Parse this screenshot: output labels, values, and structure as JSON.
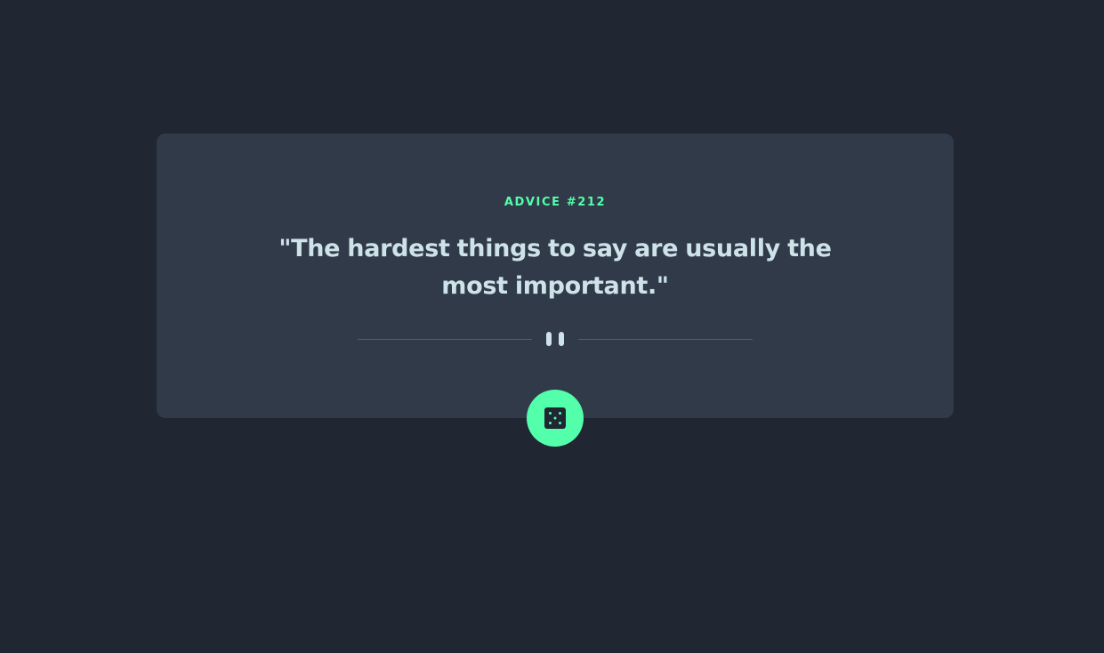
{
  "advice": {
    "label": "ADVICE #212",
    "text": "\"The hardest things to say are usually the most important.\""
  },
  "divider": {
    "icon": "pause-icon"
  },
  "button": {
    "icon": "dice-icon",
    "aria_label": "Get new advice"
  },
  "colors": {
    "background": "#202632",
    "card": "#313a48",
    "accent": "#53ffaa",
    "text": "#cee3e9",
    "divider": "#4f5d74"
  }
}
